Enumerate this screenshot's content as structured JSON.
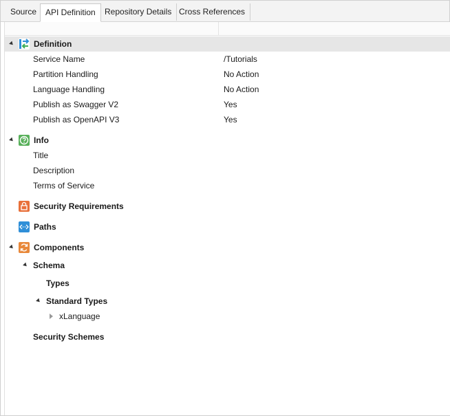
{
  "tabs": [
    {
      "label": "Source"
    },
    {
      "label": "API Definition"
    },
    {
      "label": "Repository Details"
    },
    {
      "label": "Cross References"
    }
  ],
  "tree": {
    "definition": {
      "label": "Definition",
      "props": [
        {
          "name": "Service Name",
          "value": "/Tutorials"
        },
        {
          "name": "Partition Handling",
          "value": "No Action"
        },
        {
          "name": "Language Handling",
          "value": "No Action"
        },
        {
          "name": "Publish as Swagger V2",
          "value": "Yes"
        },
        {
          "name": "Publish as OpenAPI V3",
          "value": "Yes"
        }
      ]
    },
    "info": {
      "label": "Info",
      "props": [
        {
          "name": "Title"
        },
        {
          "name": "Description"
        },
        {
          "name": "Terms of Service"
        }
      ]
    },
    "security_requirements": {
      "label": "Security Requirements"
    },
    "paths": {
      "label": "Paths"
    },
    "components": {
      "label": "Components",
      "schema": "Schema",
      "types": "Types",
      "standard_types": "Standard Types",
      "xlanguage": "xLanguage",
      "security_schemes": "Security Schemes"
    }
  },
  "colors": {
    "definition_icon": "#2f8fd8",
    "info_icon": "#58b05a",
    "security_icon": "#e8703a",
    "paths_icon": "#2f8fd8",
    "components_icon": "#e8883a",
    "selected_row": "#e6e6e6"
  },
  "icons": {
    "definition": "definition-icon",
    "info": "question-icon",
    "security": "lock-icon",
    "paths": "code-arrows-icon",
    "components": "refresh-icon"
  }
}
